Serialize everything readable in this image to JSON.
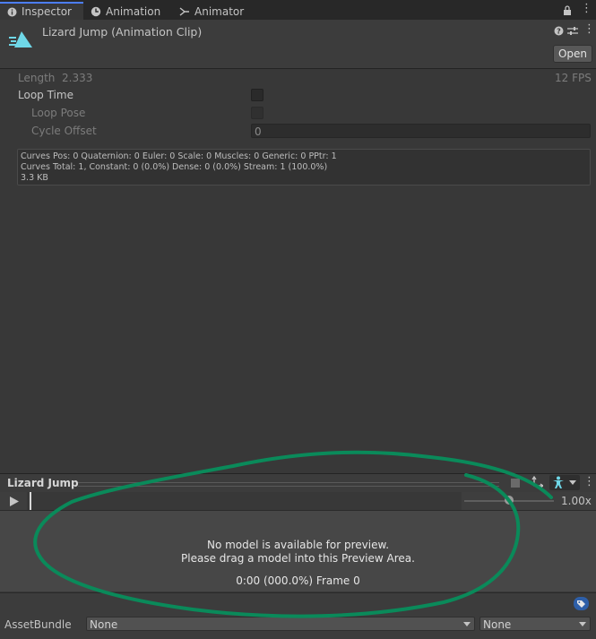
{
  "tabs": [
    {
      "label": "Inspector",
      "active": true
    },
    {
      "label": "Animation"
    },
    {
      "label": "Animator"
    }
  ],
  "header": {
    "title": "Lizard Jump (Animation Clip)",
    "open_label": "Open"
  },
  "clip": {
    "length_label": "Length",
    "length_value": "2.333",
    "fps": "12 FPS",
    "loop_time_label": "Loop Time",
    "loop_pose_label": "Loop Pose",
    "cycle_offset_label": "Cycle Offset",
    "cycle_offset_value": "0"
  },
  "info": {
    "line1": "Curves Pos: 0 Quaternion: 0 Euler: 0 Scale: 0 Muscles: 0 Generic: 0 PPtr: 1",
    "line2": "Curves Total: 1, Constant: 0 (0.0%) Dense: 0 (0.0%) Stream: 1 (100.0%)",
    "line3": "3.3 KB"
  },
  "preview": {
    "title": "Lizard Jump",
    "speed": "1.00x",
    "msg1": "No model is available for preview.",
    "msg2": "Please drag a model into this Preview Area.",
    "time": "0:00 (000.0%) Frame 0"
  },
  "assetbundle": {
    "label": "AssetBundle",
    "name": "None",
    "variant": "None"
  },
  "colors": {
    "accent": "#4c7eff",
    "annotation": "#0a8a5a",
    "tag_badge": "#2e5fa8"
  }
}
